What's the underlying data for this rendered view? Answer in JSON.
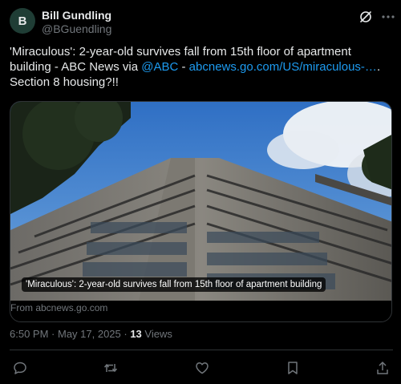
{
  "author": {
    "avatar_initial": "B",
    "name": "Bill Gundling",
    "handle": "@BGuendling"
  },
  "tweet": {
    "text_part1": "'Miraculous': 2-year-old survives fall from 15th floor of apartment building - ABC News via ",
    "mention": "@ABC",
    "text_part2": " - ",
    "link": "abcnews.go.com/US/miraculous-…",
    "text_part3": ". Section 8 housing?!!"
  },
  "media": {
    "caption": "'Miraculous': 2-year-old survives fall from 15th floor of apartment building",
    "source": "From abcnews.go.com"
  },
  "meta": {
    "time": "6:50 PM",
    "separator": " · ",
    "date": "May 17, 2025",
    "views_count": "13",
    "views_label": " Views"
  },
  "actions": {
    "reply_icon": "reply-icon",
    "retweet_icon": "retweet-icon",
    "like_icon": "heart-icon",
    "bookmark_icon": "bookmark-icon",
    "share_icon": "share-icon"
  },
  "colors": {
    "background": "#000000",
    "text": "#e7e9ea",
    "secondary": "#71767b",
    "link": "#1d9bf0",
    "border": "#2f3336"
  }
}
